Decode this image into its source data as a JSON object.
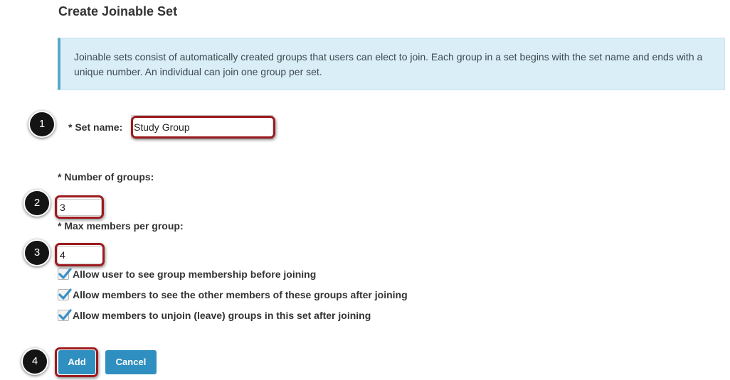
{
  "page": {
    "title": "Create Joinable Set",
    "info_text": "Joinable sets consist of automatically created groups that users can elect to join. Each group in a set begins with the set name and ends with a unique number. An individual can join one group per set."
  },
  "form": {
    "set_name_label": "* Set name:",
    "set_name_value": "Study Group",
    "num_groups_label": "* Number of groups:",
    "num_groups_value": "3",
    "max_members_label": "* Max members per group:",
    "max_members_value": "4",
    "checkboxes": [
      {
        "label": "Allow user to see group membership before joining",
        "checked": true
      },
      {
        "label": "Allow members to see the other members of these groups after joining",
        "checked": true
      },
      {
        "label": "Allow members to unjoin (leave) groups in this set after joining",
        "checked": true
      }
    ],
    "add_label": "Add",
    "cancel_label": "Cancel"
  },
  "steps": [
    "1",
    "2",
    "3",
    "4"
  ],
  "colors": {
    "info_bg": "#d9eef7",
    "info_border": "#5aa7c7",
    "highlight": "#9c1b1f",
    "button": "#2f8fc0",
    "step_badge": "#141414",
    "check": "#3a8fc8"
  },
  "icons": [
    "checkmark-icon"
  ]
}
